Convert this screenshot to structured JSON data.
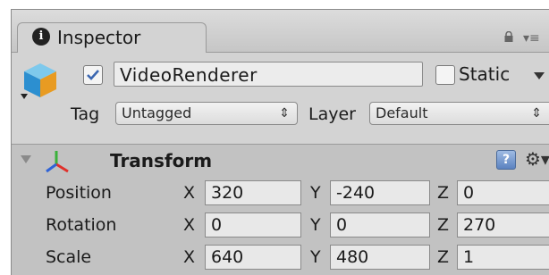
{
  "tab": {
    "title": "Inspector",
    "info_glyph": "i"
  },
  "gameobject": {
    "active": true,
    "name": "VideoRenderer",
    "static_label": "Static",
    "static_checked": false,
    "tag_label": "Tag",
    "tag_value": "Untagged",
    "layer_label": "Layer",
    "layer_value": "Default"
  },
  "transform": {
    "title": "Transform",
    "help_glyph": "?",
    "rows": [
      {
        "label": "Position",
        "x": "320",
        "y": "-240",
        "z": "0"
      },
      {
        "label": "Rotation",
        "x": "0",
        "y": "0",
        "z": "270"
      },
      {
        "label": "Scale",
        "x": "640",
        "y": "480",
        "z": "1"
      }
    ],
    "axis_labels": {
      "x": "X",
      "y": "Y",
      "z": "Z"
    }
  },
  "icons": {
    "info": "info-icon",
    "lock": "lock-icon",
    "menu": "menu-icon",
    "gameobject": "cube-icon",
    "foldout": "foldout-triangle-icon",
    "transform": "transform-axes-icon",
    "help": "help-icon",
    "gear": "gear-icon"
  },
  "colors": {
    "panel": "#c2c2c2",
    "header": "#d3d3d3",
    "field": "#e8e8e8",
    "check": "#3a66b0"
  }
}
